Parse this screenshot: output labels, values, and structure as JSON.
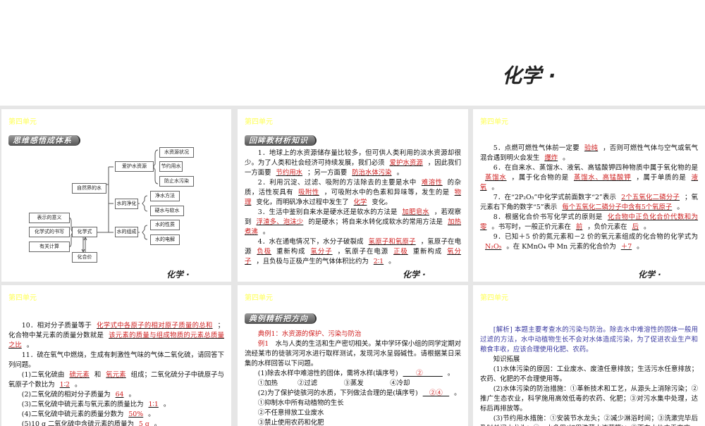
{
  "header": {
    "title": "化学 ·"
  },
  "panels": [
    {
      "unit": "第四单元",
      "banner": "思维感悟成体系",
      "footer": "化学 ·",
      "mindmap": {
        "root": "自然界的水",
        "protect": "爱护水资源",
        "protect_items": [
          "水资源状况",
          "节约用水",
          "防止水污染"
        ],
        "purify": "水的净化",
        "purify_items": [
          "净水方法",
          "硬水与软水"
        ],
        "compose": "水的组成",
        "compose_items": [
          "水的性质",
          "水的电解"
        ],
        "formula": "化学式",
        "formula_items": [
          "表示的意义",
          "化学式的书写",
          "有关计算"
        ],
        "valence": "化合价"
      }
    },
    {
      "unit": "第四单元",
      "banner": "回眸教材析知识",
      "footer": "化学 ·",
      "paras": [
        [
          {
            "t": "1．地球上的水资源储存量比较多，但可供人类利用的淡水资源却很少。为了人类和社会经济可持续发展，我们必须"
          },
          {
            "b": "爱护水资源"
          },
          {
            "t": "，因此我们一方面要"
          },
          {
            "b": "节约用水"
          },
          {
            "t": "；另一方面要"
          },
          {
            "b": "防治水体污染"
          },
          {
            "t": "。"
          }
        ],
        [
          {
            "t": "2．利用沉淀、过滤、吸附的方法除去的主要是水中"
          },
          {
            "b": "难溶性"
          },
          {
            "t": "的杂质，活性炭具有"
          },
          {
            "b": "吸附性"
          },
          {
            "t": "，可吸附水中的色素和异味等，发生的是"
          },
          {
            "b": "物理"
          },
          {
            "t": "变化，而明矾净水过程中发生了"
          },
          {
            "b": "化学"
          },
          {
            "t": "变化。"
          }
        ],
        [
          {
            "t": "3．生活中鉴别自来水是硬水还是软水的方法是"
          },
          {
            "b": "加肥皂水"
          },
          {
            "t": "，若观察到"
          },
          {
            "b": "浮渣多、泡沫少"
          },
          {
            "t": "的是硬水；将自来水转化成软水的常用方法是"
          },
          {
            "b": "加热煮沸"
          },
          {
            "t": "。"
          }
        ],
        [
          {
            "t": "4．水在通电情况下，水分子破裂成"
          },
          {
            "b": "氢原子和氧原子"
          },
          {
            "t": "，氢原子在电源"
          },
          {
            "b": "负极"
          },
          {
            "t": "重新构成"
          },
          {
            "b": "氢分子"
          },
          {
            "t": "，氧原子在电源"
          },
          {
            "b": "正极"
          },
          {
            "t": "重新构成"
          },
          {
            "b": "氧分子"
          },
          {
            "t": "，且负极与正极产生的气体体积比约为"
          },
          {
            "b": "2∶1"
          },
          {
            "t": "。"
          }
        ]
      ]
    },
    {
      "unit": "第四单元",
      "footer": "化学 ·",
      "paras": [
        [
          {
            "t": "5．点燃可燃性气体前一定要"
          },
          {
            "b": "验纯"
          },
          {
            "t": "，否则可燃性气体与空气或氧气混合遇到明火会发生"
          },
          {
            "b": "爆炸"
          },
          {
            "t": "。"
          }
        ],
        [
          {
            "t": "6．在自来水、蒸馏水、液氧、高锰酸钾四种物质中属于氧化物的是"
          },
          {
            "b": "蒸馏水"
          },
          {
            "t": "，属于化合物的是"
          },
          {
            "b": "蒸馏水、高锰酸钾"
          },
          {
            "t": "，属于单质的是"
          },
          {
            "b": "液氧"
          },
          {
            "t": "。"
          }
        ],
        [
          {
            "t": "7．在“2P₂O₅”中化学式前面数字“2”表示"
          },
          {
            "b": "2个五氧化二磷分子"
          },
          {
            "t": "；氧元素右下角的数字“5”表示"
          },
          {
            "b": "每个五氧化二磷分子中含有5个氧原子"
          },
          {
            "t": "。"
          }
        ],
        [
          {
            "t": "8．根据化合价书写化学式的原则是"
          },
          {
            "b": "化合物中正负化合价代数和为零"
          },
          {
            "t": "。书写时，一般正价元素在"
          },
          {
            "b": "前"
          },
          {
            "t": "，负价元素在"
          },
          {
            "b": "后"
          },
          {
            "t": "。"
          }
        ],
        [
          {
            "t": "9．已知＋5 价的氮元素和－2 价的氧元素组成的化合物的化学式为"
          },
          {
            "b": "N₂O₅"
          },
          {
            "t": "。在 KMnO₄ 中 Mn 元素的化合价为"
          },
          {
            "b": "＋7"
          },
          {
            "t": "。"
          }
        ]
      ]
    },
    {
      "unit": "第四单元",
      "paras": [
        [
          {
            "t": "10．相对分子质量等于"
          },
          {
            "b": "化学式中各原子的相对原子质量的总和"
          },
          {
            "t": "；化合物中某元素的质量分数就是"
          },
          {
            "b": "该元素的质量与组成物质的元素总质量之比"
          },
          {
            "t": "。"
          }
        ],
        [
          {
            "t": "11．硫在氧气中燃烧，生成有刺激性气味的气体二氧化硫，请回答下列问题。"
          }
        ],
        [
          {
            "t": "(1)二氧化硫由"
          },
          {
            "b": "硫元素"
          },
          {
            "t": "和"
          },
          {
            "b": "氧元素"
          },
          {
            "t": "组成；二氧化硫分子中硫原子与氧原子个数比为"
          },
          {
            "b": "1∶2"
          },
          {
            "t": "。"
          }
        ],
        [
          {
            "t": "(2)二氧化硫的相对分子质量为"
          },
          {
            "b": "64"
          },
          {
            "t": "。"
          }
        ],
        [
          {
            "t": "(3)二氧化硫中硫元素与氧元素的质量比为"
          },
          {
            "b": "1∶1"
          },
          {
            "t": "。"
          }
        ],
        [
          {
            "t": "(4)二氧化硫中硫元素的质量分数为"
          },
          {
            "b": "50%"
          },
          {
            "t": "。"
          }
        ],
        [
          {
            "t": "(5)10 g 二氧化硫中含硫元素的质量为"
          },
          {
            "b": "5 g"
          },
          {
            "t": "。"
          }
        ]
      ]
    },
    {
      "unit": "第四单元",
      "banner": "典例精析把方向",
      "paras": [
        [
          {
            "r": "典例1：水资源的保护、污染与防治"
          }
        ],
        [
          {
            "r": "例1　"
          },
          {
            "t": "水与人类的生活和生产密切相关。某中学环保小组的同学定期对流经某市的徒骇河河水进行取样测试，发现河水呈弱碱性。请根据某日采集的水样回答以下问题。"
          }
        ],
        [
          {
            "t": "(1)除去水样中难溶性的固体，需将水样(填序号)"
          },
          {
            "b": "　　②　　　"
          },
          {
            "t": "。"
          }
        ],
        [
          {
            "t": "①加热　　　②过滤　　　　③蒸发　　　　④冷却"
          }
        ],
        [
          {
            "t": "(2)为了保护徒骇河的水质，下列做法合理的是(填序号)"
          },
          {
            "b": "　②④　"
          },
          {
            "t": "。"
          }
        ],
        [
          {
            "t": "①抑制水中所有动植物的生长"
          }
        ],
        [
          {
            "t": "②不任意排放工业废水"
          }
        ],
        [
          {
            "t": "③禁止使用农药和化肥"
          }
        ]
      ]
    },
    {
      "unit": "第四单元",
      "paras": [
        [
          {
            "u": "[解析] 本题主要考查水的污染与防治。除去水中难溶性的固体一般用过滤的方法，水中动植物生长不会对水体造成污染，为了促进农业生产和粮食丰收，应该合理使用化肥、农药。"
          }
        ],
        [
          {
            "t": "知识拓展"
          }
        ],
        [
          {
            "t": "(1)水体污染的原因：工业废水、废渣任意排放；生活污水任意排放；农药、化肥的不合理使用等。"
          }
        ],
        [
          {
            "t": "(2)水体污染的防治措施：①革新技术和工艺，从源头上消除污染；②推广生态农业，科学施用高效低毒的农药、化肥；③对污水集中处理，达标后再排放等。"
          }
        ],
        [
          {
            "t": "(3)节约用水措施：①安装节水龙头；②减少淋浴时间；③洗漱完毕后及时关闭水龙头；④一水多用(如用洗菜水浇花等)；⑤不向水体中丢弃废"
          }
        ]
      ]
    }
  ]
}
